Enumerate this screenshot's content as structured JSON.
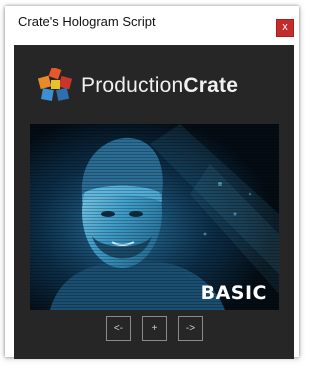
{
  "window": {
    "title": "Crate's Hologram Script",
    "close_label": "x"
  },
  "brand": {
    "name_regular": "Production",
    "name_bold": "Crate",
    "colors": {
      "orange": "#e8572a",
      "blue": "#3d8fd4",
      "red": "#c9352b"
    }
  },
  "preview": {
    "label": "BASIC",
    "tint": "#3aa6d6"
  },
  "nav": {
    "prev_label": "<-",
    "add_label": "+",
    "next_label": "->"
  },
  "colors": {
    "panel_bg": "#262626",
    "close_bg": "#c42b2b"
  }
}
